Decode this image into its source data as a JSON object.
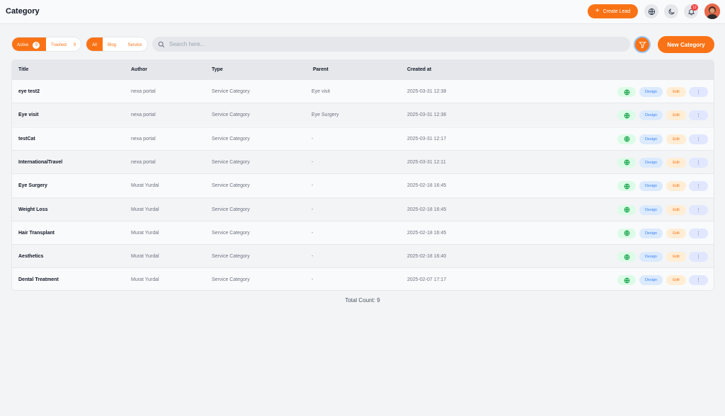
{
  "header": {
    "title": "Category",
    "create_lead_label": "Create Lead",
    "notification_count": "12"
  },
  "filters": {
    "status": [
      {
        "label": "Active",
        "count": "9"
      },
      {
        "label": "Trashed",
        "count": "0"
      }
    ],
    "types": [
      "All",
      "Blog",
      "Service"
    ],
    "search_placeholder": "Search here...",
    "new_category_label": "New Category"
  },
  "table": {
    "columns": [
      "Title",
      "Author",
      "Type",
      "Parent",
      "Created at"
    ],
    "action_labels": {
      "design": "Design",
      "edit": "Edit"
    },
    "rows": [
      {
        "title": "eye test2",
        "author": "nexa portal",
        "type": "Service Category",
        "parent": "Eye visit",
        "created": "2025-03-31 12:38"
      },
      {
        "title": "Eye visit",
        "author": "nexa portal",
        "type": "Service Category",
        "parent": "Eye Surgery",
        "created": "2025-03-31 12:36"
      },
      {
        "title": "testCat",
        "author": "nexa portal",
        "type": "Service Category",
        "parent": "-",
        "created": "2025-03-31 12:17"
      },
      {
        "title": "InternationalTravel",
        "author": "nexa portal",
        "type": "Service Category",
        "parent": "-",
        "created": "2025-03-31 12:11"
      },
      {
        "title": "Eye Surgery",
        "author": "Murat Yurdal",
        "type": "Service Category",
        "parent": "-",
        "created": "2025-02-18 16:45"
      },
      {
        "title": "Weight Loss",
        "author": "Murat Yurdal",
        "type": "Service Category",
        "parent": "-",
        "created": "2025-02-18 16:45"
      },
      {
        "title": "Hair Transplant",
        "author": "Murat Yurdal",
        "type": "Service Category",
        "parent": "-",
        "created": "2025-02-18 16:45"
      },
      {
        "title": "Aesthetics",
        "author": "Murat Yurdal",
        "type": "Service Category",
        "parent": "-",
        "created": "2025-02-18 16:40"
      },
      {
        "title": "Dental Treatment",
        "author": "Murat Yurdal",
        "type": "Service Category",
        "parent": "-",
        "created": "2025-02-07 17:17"
      }
    ]
  },
  "footer": {
    "total_count": "Total Count: 9"
  },
  "colors": {
    "accent": "#f97316",
    "design": "#3b82f6",
    "globe": "#16a34a",
    "badge": "#ef4444"
  }
}
